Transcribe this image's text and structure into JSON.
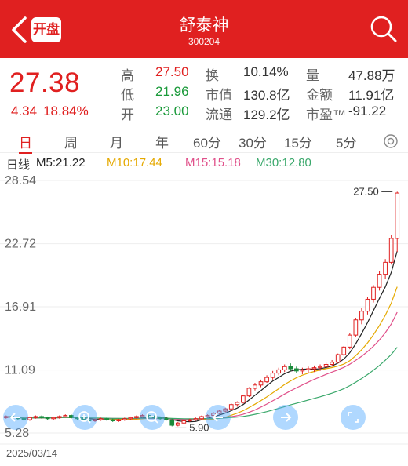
{
  "header": {
    "title": "舒泰神",
    "code": "300204",
    "badge": "开盘"
  },
  "quote": {
    "price": "27.38",
    "change": "4.34",
    "change_pct": "18.84%",
    "stats": [
      [
        {
          "label": "高",
          "value": "27.50",
          "color": "red"
        },
        {
          "label": "换",
          "value": "10.14%",
          "color": "plain"
        },
        {
          "label": "量",
          "value": "47.88万",
          "color": "plain"
        }
      ],
      [
        {
          "label": "低",
          "value": "21.96",
          "color": "green"
        },
        {
          "label": "市值",
          "value": "130.8亿",
          "color": "plain"
        },
        {
          "label": "金额",
          "value": "11.91亿",
          "color": "plain"
        }
      ],
      [
        {
          "label": "开",
          "value": "23.00",
          "color": "green"
        },
        {
          "label": "流通",
          "value": "129.2亿",
          "color": "plain"
        },
        {
          "label": "市盈™",
          "value": "-91.22",
          "color": "plain"
        }
      ]
    ]
  },
  "periods": [
    "日",
    "周",
    "月",
    "年",
    "60分",
    "30分",
    "15分",
    "5分"
  ],
  "ma": {
    "label": "日线",
    "m5": "M5:21.22",
    "m10": "M10:17.44",
    "m15": "M15:15.18",
    "m30": "M30:12.80"
  },
  "colors": {
    "accent": "#e02020",
    "up": "#e02020",
    "down": "#1a8a3a",
    "m5": "#222222",
    "m10": "#e5a900",
    "m15": "#e0508a",
    "m30": "#3aa86b"
  },
  "chart_data": {
    "type": "candlestick",
    "y_ticks": [
      "28.54",
      "22.72",
      "16.91",
      "11.09",
      "5.28"
    ],
    "ylim": [
      5.28,
      28.54
    ],
    "start_date": "2025/03/14",
    "max_label": "27.50",
    "min_label": "5.90",
    "candles": [
      [
        6.7,
        6.9,
        6.6,
        6.8
      ],
      [
        6.8,
        6.9,
        6.6,
        6.7
      ],
      [
        6.7,
        6.8,
        6.5,
        6.6
      ],
      [
        6.6,
        6.7,
        6.4,
        6.5
      ],
      [
        6.5,
        6.8,
        6.4,
        6.7
      ],
      [
        6.7,
        6.9,
        6.6,
        6.8
      ],
      [
        6.8,
        6.9,
        6.6,
        6.7
      ],
      [
        6.7,
        6.8,
        6.5,
        6.6
      ],
      [
        6.6,
        6.8,
        6.5,
        6.7
      ],
      [
        6.7,
        6.9,
        6.6,
        6.8
      ],
      [
        6.8,
        7.0,
        6.7,
        6.9
      ],
      [
        6.9,
        7.0,
        6.6,
        6.7
      ],
      [
        6.7,
        6.8,
        6.5,
        6.6
      ],
      [
        6.6,
        6.7,
        6.4,
        6.5
      ],
      [
        6.5,
        6.6,
        6.3,
        6.4
      ],
      [
        6.4,
        6.6,
        6.3,
        6.5
      ],
      [
        6.5,
        6.7,
        6.4,
        6.6
      ],
      [
        6.6,
        6.7,
        6.4,
        6.5
      ],
      [
        6.5,
        6.6,
        6.3,
        6.4
      ],
      [
        6.4,
        6.6,
        6.3,
        6.5
      ],
      [
        6.5,
        6.7,
        6.4,
        6.6
      ],
      [
        6.6,
        6.8,
        6.5,
        6.7
      ],
      [
        6.7,
        6.9,
        6.6,
        6.8
      ],
      [
        6.8,
        7.0,
        6.7,
        6.9
      ],
      [
        6.9,
        7.0,
        6.7,
        6.8
      ],
      [
        6.8,
        6.9,
        6.6,
        6.7
      ],
      [
        6.7,
        6.8,
        6.5,
        6.6
      ],
      [
        6.6,
        6.7,
        6.4,
        6.5
      ],
      [
        6.5,
        6.6,
        5.9,
        6.0
      ],
      [
        6.0,
        6.3,
        5.9,
        6.2
      ],
      [
        6.2,
        6.5,
        6.1,
        6.4
      ],
      [
        6.4,
        6.6,
        6.3,
        6.5
      ],
      [
        6.5,
        6.7,
        6.4,
        6.6
      ],
      [
        6.6,
        6.9,
        6.5,
        6.8
      ],
      [
        6.8,
        7.0,
        6.7,
        6.9
      ],
      [
        6.9,
        7.2,
        6.8,
        7.1
      ],
      [
        7.1,
        7.4,
        7.0,
        7.3
      ],
      [
        7.3,
        7.6,
        7.2,
        7.5
      ],
      [
        7.5,
        8.0,
        7.4,
        7.9
      ],
      [
        7.9,
        8.2,
        7.7,
        8.1
      ],
      [
        8.1,
        8.8,
        8.0,
        8.7
      ],
      [
        8.7,
        9.5,
        8.6,
        9.4
      ],
      [
        9.4,
        9.9,
        9.2,
        9.7
      ],
      [
        9.7,
        10.2,
        9.5,
        10.0
      ],
      [
        10.0,
        10.6,
        9.9,
        10.4
      ],
      [
        10.4,
        11.0,
        10.2,
        10.8
      ],
      [
        10.8,
        11.3,
        10.6,
        11.1
      ],
      [
        11.1,
        11.6,
        10.9,
        11.4
      ],
      [
        11.4,
        11.7,
        11.0,
        11.2
      ],
      [
        11.2,
        11.4,
        10.8,
        11.0
      ],
      [
        11.0,
        11.3,
        10.7,
        11.1
      ],
      [
        11.1,
        11.4,
        10.8,
        11.2
      ],
      [
        11.2,
        11.5,
        10.9,
        11.3
      ],
      [
        11.3,
        11.6,
        11.0,
        11.4
      ],
      [
        11.4,
        11.8,
        11.2,
        11.6
      ],
      [
        11.6,
        12.0,
        11.4,
        11.8
      ],
      [
        11.8,
        12.6,
        11.7,
        12.5
      ],
      [
        12.5,
        13.3,
        12.4,
        13.2
      ],
      [
        13.2,
        14.5,
        13.0,
        14.3
      ],
      [
        14.3,
        15.9,
        14.1,
        15.7
      ],
      [
        15.7,
        16.8,
        15.3,
        16.5
      ],
      [
        16.5,
        17.8,
        16.2,
        17.6
      ],
      [
        17.6,
        18.9,
        17.3,
        18.7
      ],
      [
        18.7,
        20.2,
        18.4,
        19.9
      ],
      [
        19.9,
        21.3,
        19.5,
        21.0
      ],
      [
        21.0,
        23.5,
        20.8,
        23.2
      ],
      [
        23.2,
        27.5,
        21.96,
        27.38
      ]
    ]
  }
}
